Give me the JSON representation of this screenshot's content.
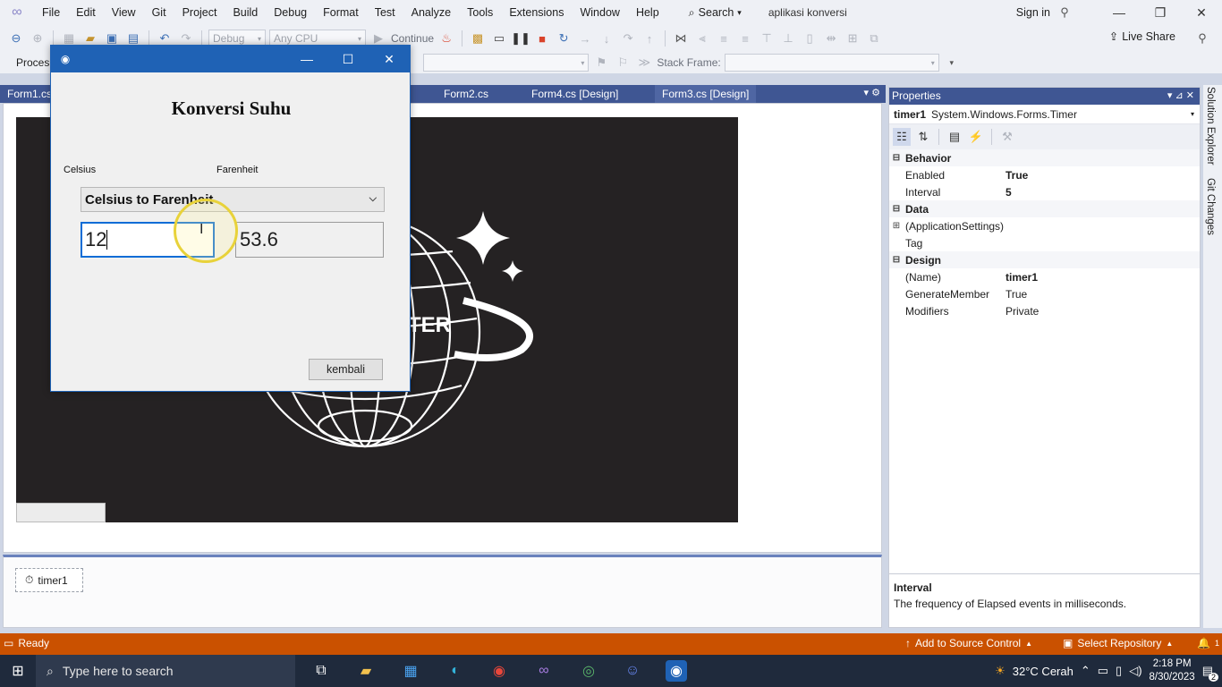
{
  "menu": {
    "items": [
      "File",
      "Edit",
      "View",
      "Git",
      "Project",
      "Build",
      "Debug",
      "Format",
      "Test",
      "Analyze",
      "Tools",
      "Extensions",
      "Window",
      "Help"
    ],
    "search_label": "Search",
    "solution_name": "aplikasi konversi",
    "sign_in": "Sign in"
  },
  "toolbar": {
    "config": "Debug",
    "platform": "Any CPU",
    "continue_label": "Continue",
    "live_share": "Live Share",
    "process_label": "Proces",
    "stack_frame_label": "Stack Frame:"
  },
  "doc_tabs": [
    "Form1.cs",
    "Form2.cs",
    "Form4.cs [Design]",
    "Form3.cs [Design]"
  ],
  "tray": {
    "timer_label": "timer1"
  },
  "app": {
    "title": "Konversi Suhu",
    "label_left": "Celsius",
    "label_right": "Farenheit",
    "mode": "Celsius to Farenheit",
    "input_value": "12",
    "output_value": "53.6",
    "back_button": "kembali",
    "canvas_text": "TER"
  },
  "properties": {
    "header": "Properties",
    "object_name": "timer1",
    "object_type": "System.Windows.Forms.Timer",
    "categories": [
      {
        "name": "Behavior",
        "rows": [
          {
            "name": "Enabled",
            "value": "True",
            "bold": true
          },
          {
            "name": "Interval",
            "value": "5",
            "bold": true
          }
        ]
      },
      {
        "name": "Data",
        "rows": [
          {
            "name": "(ApplicationSettings)",
            "value": "",
            "expandable": true
          },
          {
            "name": "Tag",
            "value": ""
          }
        ]
      },
      {
        "name": "Design",
        "rows": [
          {
            "name": "(Name)",
            "value": "timer1",
            "bold": true
          },
          {
            "name": "GenerateMember",
            "value": "True"
          },
          {
            "name": "Modifiers",
            "value": "Private"
          }
        ]
      }
    ],
    "desc_title": "Interval",
    "desc_text": "The frequency of Elapsed events in milliseconds."
  },
  "side_tabs": [
    "Solution Explorer",
    "Git Changes"
  ],
  "status": {
    "ready": "Ready",
    "add_source": "Add to Source Control",
    "select_repo": "Select Repository",
    "notifications": "1"
  },
  "taskbar": {
    "search_placeholder": "Type here to search",
    "weather": "32°C  Cerah",
    "time": "2:18 PM",
    "date": "8/30/2023",
    "notif_count": "2"
  },
  "colors": {
    "accent": "#3f5693",
    "status_bar": "#ca5100",
    "app_titlebar": "#1f62b5",
    "canvas_bg": "#252223"
  }
}
